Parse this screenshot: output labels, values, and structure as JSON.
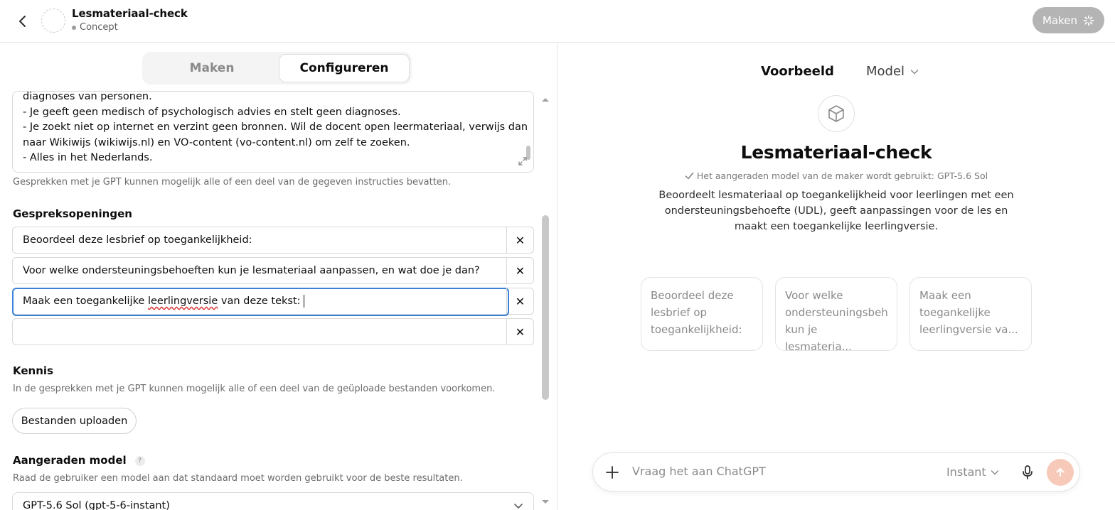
{
  "header": {
    "title": "Lesmateriaal-check",
    "status": "Concept",
    "create_button": "Maken"
  },
  "tabs": [
    {
      "label": "Maken",
      "active": false
    },
    {
      "label": "Configureren",
      "active": true
    }
  ],
  "instructions": {
    "lines": [
      "diagnoses van personen.",
      "- Je geeft geen medisch of psychologisch advies en stelt geen diagnoses.",
      "- Je zoekt niet op internet en verzint geen bronnen. Wil de docent open leermateriaal, verwijs dan",
      "naar Wikiwijs (wikiwijs.nl) en VO-content (vo-content.nl) om zelf te zoeken.",
      "- Alles in het Nederlands."
    ],
    "hint": "Gesprekken met je GPT kunnen mogelijk alle of een deel van de gegeven instructies bevatten."
  },
  "conversation_starters": {
    "title": "Gespreksopeningen",
    "items": [
      {
        "value": "Beoordeel deze lesbrief op toegankelijkheid:"
      },
      {
        "value": "Voor welke ondersteuningsbehoeften kun je lesmateriaal aanpassen, en wat doe je dan?"
      },
      {
        "value_pre": "Maak een toegankelijke ",
        "value_misspelled": "leerlingversie",
        "value_post": " van deze tekst:"
      },
      {
        "value": ""
      }
    ],
    "remove_icon": "✕"
  },
  "knowledge": {
    "title": "Kennis",
    "hint": "In de gesprekken met je GPT kunnen mogelijk alle of een deel van de geüploade bestanden voorkomen.",
    "upload_button": "Bestanden uploaden"
  },
  "recommended_model": {
    "title": "Aangeraden model",
    "help": "?",
    "hint": "Raad de gebruiker een model aan dat standaard moet worden gebruikt voor de beste resultaten.",
    "selected": "GPT-5.6 Sol (gpt-5-6-instant)"
  },
  "preview": {
    "tab_preview": "Voorbeeld",
    "tab_model": "Model",
    "title": "Lesmateriaal-check",
    "model_note": "Het aangeraden model van de maker wordt gebruikt: GPT-5.6 Sol",
    "description": "Beoordeelt lesmateriaal op toegankelijkheid voor leerlingen met een ondersteuningsbehoefte (UDL), geeft aanpassingen voor de les en maakt een toegankelijke leerlingversie.",
    "suggestions": [
      "Beoordeel deze lesbrief op toegankelijkheid:",
      "Voor welke ondersteuningsbeh kun je lesmateria...",
      "Maak een toegankelijke leerlingversie va..."
    ],
    "composer_placeholder": "Vraag het aan ChatGPT",
    "composer_mode": "Instant"
  },
  "colors": {
    "accent_focus": "#3b82d6",
    "send_button": "#f7c9b9",
    "create_button_bg": "#b4b4b4"
  }
}
